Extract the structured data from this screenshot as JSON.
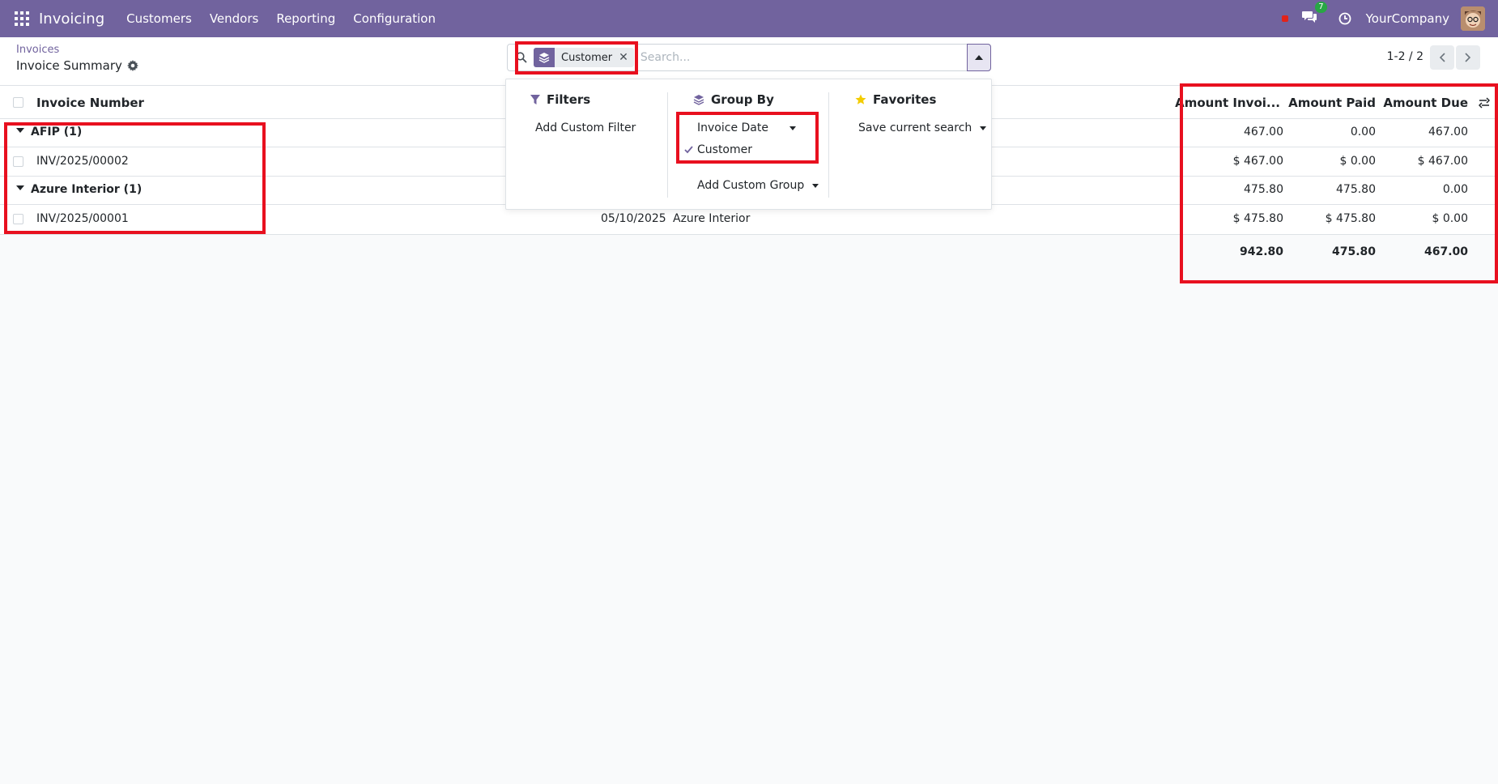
{
  "navbar": {
    "app_name": "Invoicing",
    "menu": [
      "Customers",
      "Vendors",
      "Reporting",
      "Configuration"
    ],
    "chat_count": "7",
    "company": "YourCompany"
  },
  "breadcrumb": {
    "parent": "Invoices",
    "current": "Invoice Summary"
  },
  "search": {
    "facet_label": "Customer",
    "facet_remove": "✕",
    "placeholder": "Search...",
    "value": ""
  },
  "pager": {
    "text": "1-2 / 2"
  },
  "columns": {
    "invoice_number": "Invoice Number",
    "amount_invoiced": "Amount Invoi...",
    "amount_paid": "Amount Paid",
    "amount_due": "Amount Due"
  },
  "groups": [
    {
      "label": "AFIP (1)",
      "amount_invoiced": "467.00",
      "amount_paid": "0.00",
      "amount_due": "467.00",
      "records": [
        {
          "number": "INV/2025/00002",
          "date": "",
          "customer": "",
          "amount_invoiced": "$ 467.00",
          "amount_paid": "$ 0.00",
          "amount_due": "$ 467.00"
        }
      ]
    },
    {
      "label": "Azure Interior (1)",
      "amount_invoiced": "475.80",
      "amount_paid": "475.80",
      "amount_due": "0.00",
      "records": [
        {
          "number": "INV/2025/00001",
          "date": "05/10/2025",
          "customer": "Azure Interior",
          "amount_invoiced": "$ 475.80",
          "amount_paid": "$ 475.80",
          "amount_due": "$ 0.00"
        }
      ]
    }
  ],
  "totals": {
    "amount_invoiced": "942.80",
    "amount_paid": "475.80",
    "amount_due": "467.00"
  },
  "search_panel": {
    "filters": {
      "title": "Filters",
      "add_custom": "Add Custom Filter"
    },
    "group_by": {
      "title": "Group By",
      "options": [
        {
          "label": "Invoice Date",
          "checked": false
        },
        {
          "label": "Customer",
          "checked": true
        }
      ],
      "add_custom": "Add Custom Group"
    },
    "favorites": {
      "title": "Favorites",
      "save_search": "Save current search"
    }
  },
  "colors": {
    "brand": "#71639e",
    "highlight": "#e8101f",
    "star": "#f3cc00",
    "badge": "#28a745"
  }
}
